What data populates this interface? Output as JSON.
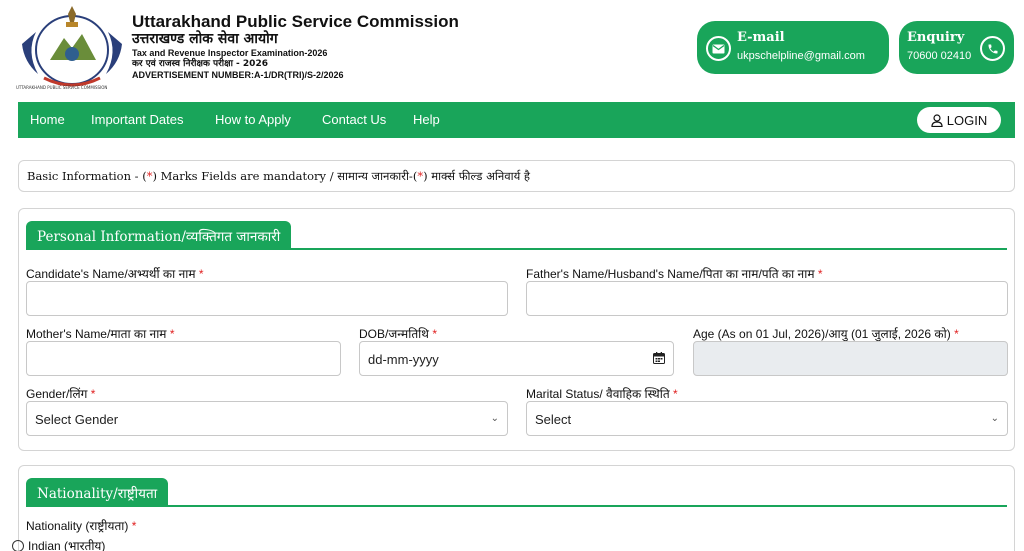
{
  "header": {
    "org_name_en": "Uttarakhand Public Service Commission",
    "org_name_hi": "उत्तराखण्ड लोक सेवा आयोग",
    "exam_en": "Tax and Revenue Inspector Examination-2026",
    "exam_hi": "कर एवं राजस्व निरीक्षक परीक्षा - 2026",
    "advertisement": "ADVERTISEMENT NUMBER:A-1/DR(TRI)/S-2/2026",
    "logo_caption": "UTTARAKHAND PUBLIC SERVICE COMMISSION",
    "email_title": "E-mail",
    "email_value": "ukpschelpline@gmail.com",
    "enquiry_title": "Enquiry",
    "enquiry_value": "70600 02410"
  },
  "nav": {
    "items": [
      "Home",
      "Important Dates",
      "How to Apply",
      "Contact Us",
      "Help"
    ],
    "login_label": "LOGIN"
  },
  "basic": {
    "prefix": "Basic Information - (",
    "star": "*",
    "middle": ") Marks Fields are mandatory / सामान्य जानकारी-(",
    "suffix": ") मार्क्स फील्ड अनिवार्य है"
  },
  "personal": {
    "title": "Personal Information/व्यक्तिगत जानकारी",
    "candidate_name_label": "Candidate's Name/अभ्यर्थी का नाम",
    "father_name_label": "Father's Name/Husband's Name/पिता का नाम/पति का नाम",
    "mother_name_label": "Mother's Name/माता का नाम",
    "dob_label": "DOB/जन्मतिथि",
    "dob_placeholder": "dd-mm-yyyy",
    "age_label": "Age (As on 01 Jul, 2026)/आयु (01 जुलाई, 2026 को)",
    "gender_label": "Gender/लिंग",
    "gender_value": "Select Gender",
    "marital_label": "Marital Status/ वैवाहिक स्थिति",
    "marital_value": "Select",
    "required_mark": "*"
  },
  "nationality": {
    "title": "Nationality/राष्ट्रीयता",
    "label": "Nationality (राष्ट्रीयता)",
    "option_indian": "Indian (भारतीय)"
  },
  "colors": {
    "accent": "#19a55a",
    "required": "#e02020"
  },
  "icons": [
    "emblem-logo",
    "email-icon",
    "phone-icon",
    "user-icon",
    "calendar-icon",
    "chevron-down-icon"
  ]
}
